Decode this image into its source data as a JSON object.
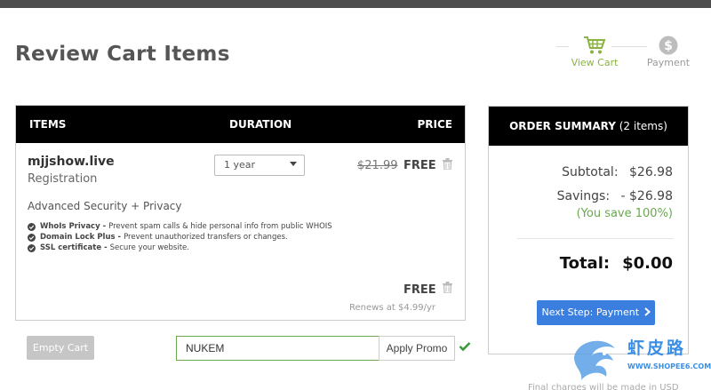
{
  "page": {
    "title": "Review Cart Items"
  },
  "steps": [
    {
      "label": "View Cart",
      "icon": "cart-icon",
      "active": true
    },
    {
      "label": "Payment",
      "icon": "dollar-icon",
      "active": false
    }
  ],
  "cart_table": {
    "headers": {
      "items": "ITEMS",
      "duration": "DURATION",
      "price": "PRICE"
    },
    "item": {
      "domain": "mjjshow.live",
      "type": "Registration",
      "duration": "1 year",
      "old_price": "$21.99",
      "price": "FREE"
    },
    "addon": {
      "title": "Advanced Security + Privacy",
      "features": [
        {
          "name": "WhoIs Privacy -",
          "desc": "Prevent spam calls & hide personal info from public WHOIS"
        },
        {
          "name": "Domain Lock Plus -",
          "desc": "Prevent unauthorized transfers or changes."
        },
        {
          "name": "SSL certificate -",
          "desc": "Secure your website."
        }
      ],
      "price": "FREE",
      "renews": "Renews at $4.99/yr"
    }
  },
  "actions": {
    "empty_cart": "Empty Cart",
    "promo_value": "NUKEM",
    "apply_promo": "Apply Promo"
  },
  "summary": {
    "title": "ORDER SUMMARY",
    "count": "(2 items)",
    "subtotal_label": "Subtotal:",
    "subtotal_value": "$26.98",
    "savings_label": "Savings:",
    "savings_value": "- $26.98",
    "save_pct": "(You save 100%)",
    "total_label": "Total:",
    "total_value": "$0.00",
    "next_button": "Next Step: Payment",
    "footnote": "Final charges will be made in USD"
  },
  "watermark": {
    "text": "虾皮路",
    "url": "WWW.SHOPEE6.COM"
  },
  "colors": {
    "accent_green": "#8ab43f",
    "button_blue": "#3a7fe0",
    "header_black": "#000000"
  }
}
